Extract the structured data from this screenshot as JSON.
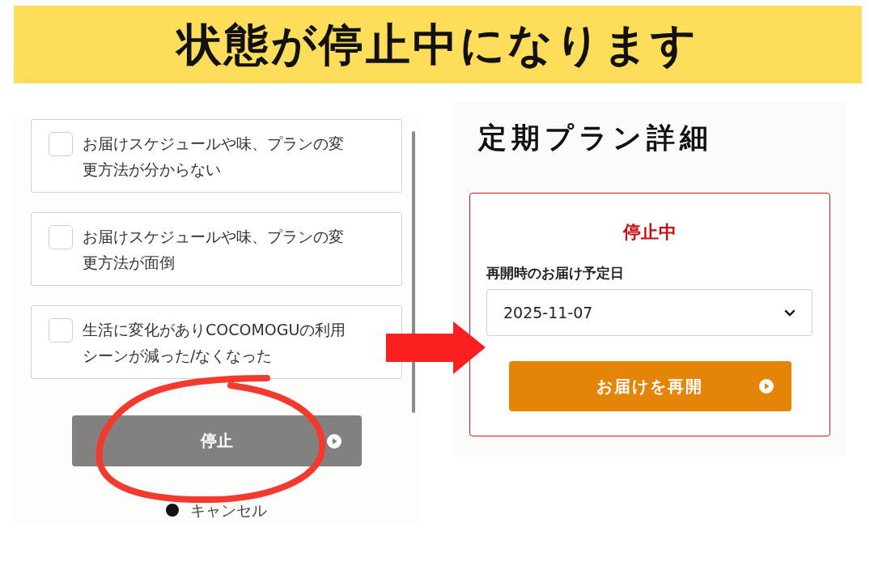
{
  "banner": {
    "title": "状態が停止中になります"
  },
  "cancel_form": {
    "reasons": [
      {
        "label": "お届けスケジュールや味、プランの変更方法が分からない",
        "checked": false
      },
      {
        "label": "お届けスケジュールや味、プランの変更方法が面倒",
        "checked": false
      },
      {
        "label": "生活に変化がありCOCOMOGUの利用シーンが減った/なくなった",
        "checked": false
      }
    ],
    "stop_button": {
      "label": "停止"
    },
    "cancel_link": {
      "label": "キャンセル"
    }
  },
  "plan_detail": {
    "title": "定期プラン詳細",
    "status": "停止中",
    "resume_date": {
      "label": "再開時のお届け予定日",
      "value": "2025-11-07"
    },
    "resume_button": {
      "label": "お届けを再開"
    }
  }
}
